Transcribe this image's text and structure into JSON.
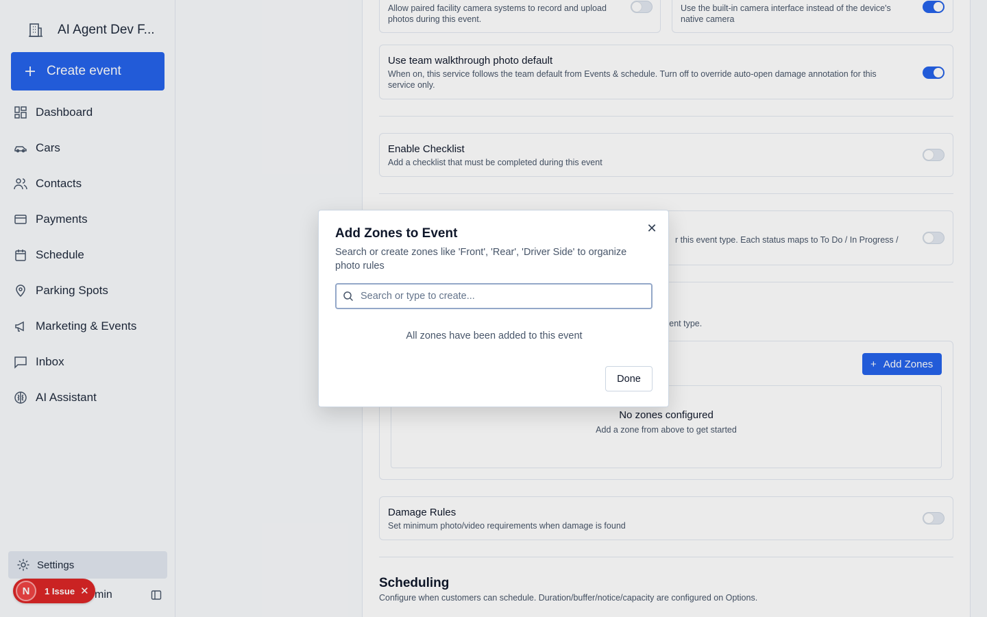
{
  "sidebar": {
    "org_name": "AI Agent Dev F...",
    "create_label": "Create event",
    "items": [
      {
        "label": "Dashboard",
        "icon": "dashboard-icon"
      },
      {
        "label": "Cars",
        "icon": "car-icon"
      },
      {
        "label": "Contacts",
        "icon": "users-icon"
      },
      {
        "label": "Payments",
        "icon": "credit-card-icon"
      },
      {
        "label": "Schedule",
        "icon": "calendar-icon"
      },
      {
        "label": "Parking Spots",
        "icon": "map-pin-icon"
      },
      {
        "label": "Marketing & Events",
        "icon": "megaphone-icon"
      },
      {
        "label": "Inbox",
        "icon": "message-icon"
      },
      {
        "label": "AI Assistant",
        "icon": "brain-icon"
      }
    ],
    "settings_label": "Settings",
    "user_name_partial": "min",
    "issue": {
      "avatar_letter": "N",
      "label": "1 Issue"
    }
  },
  "main": {
    "camera_desc": "Allow paired facility camera systems to record and upload photos during this event.",
    "builtin_desc": "Use the built-in camera interface instead of the device's native camera",
    "walkthrough": {
      "title": "Use team walkthrough photo default",
      "desc": "When on, this service follows the team default from Events & schedule. Turn off to override auto-open damage annotation for this service only."
    },
    "checklist": {
      "title": "Enable Checklist",
      "desc": "Add a checklist that must be completed during this event"
    },
    "status_desc_partial": "r this event type. Each status maps to To Do / In Progress /",
    "zones_desc_partial": "vent type.",
    "add_zones_label": "Add Zones",
    "zones_empty": {
      "title": "No zones configured",
      "desc": "Add a zone from above to get started"
    },
    "damage": {
      "title": "Damage Rules",
      "desc": "Set minimum photo/video requirements when damage is found"
    },
    "scheduling": {
      "title": "Scheduling",
      "desc": "Configure when customers can schedule. Duration/buffer/notice/capacity are configured on Options."
    }
  },
  "modal": {
    "title": "Add Zones to Event",
    "desc": "Search or create zones like 'Front', 'Rear', 'Driver Side' to organize photo rules",
    "search_placeholder": "Search or type to create...",
    "empty_msg": "All zones have been added to this event",
    "done_label": "Done"
  },
  "colors": {
    "accent": "#2563eb",
    "issue": "#dc2626"
  }
}
